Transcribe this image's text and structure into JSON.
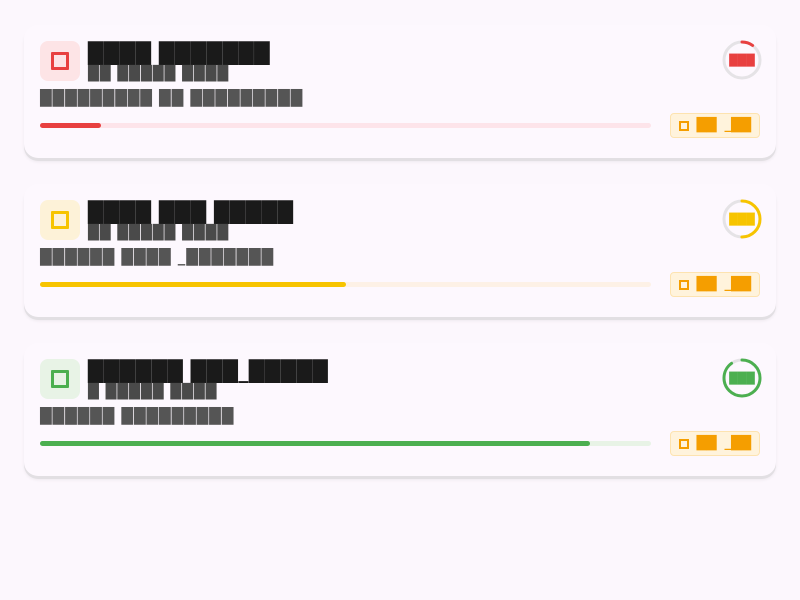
{
  "cards": [
    {
      "title": "████ ███████",
      "subtitle": "██ █████ ████",
      "description": "█████████ ██ █████████",
      "progress": 0.1,
      "progress_label": "███",
      "chip_label": "██",
      "chip_value": "_██",
      "accent": "#e84040",
      "tile_bg": "#fde4e6",
      "track": "#fde4ea",
      "icon": "square-icon"
    },
    {
      "title": "████ ███ █████",
      "subtitle": "██ █████ ████",
      "description": "██████ ████ _███████",
      "progress": 0.5,
      "progress_label": "███",
      "chip_label": "██",
      "chip_value": "_██",
      "accent": "#f7c400",
      "tile_bg": "#fdf2d8",
      "track": "#fdf1e6",
      "icon": "square-icon"
    },
    {
      "title": "██████ ███_█████",
      "subtitle": "█ █████ ████",
      "description": "██████ █████████",
      "progress": 0.9,
      "progress_label": "███",
      "chip_label": "██",
      "chip_value": "_██",
      "accent": "#4caf50",
      "tile_bg": "#e8f3e6",
      "track": "#e8f3e6",
      "icon": "square-icon"
    }
  ]
}
